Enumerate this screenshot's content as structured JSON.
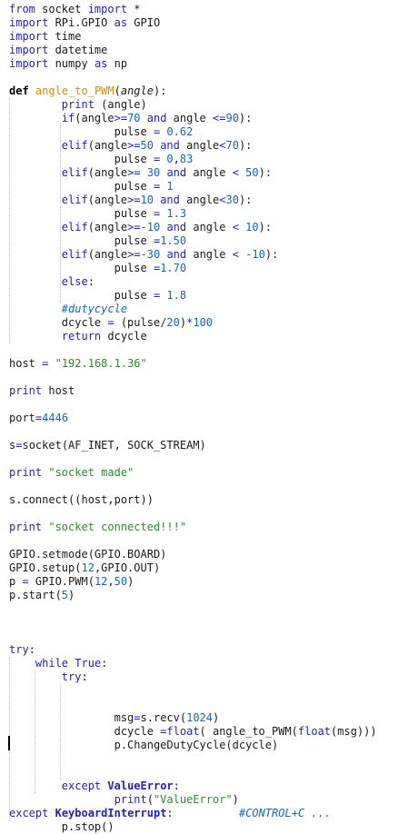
{
  "editor": {
    "language": "python",
    "lines": [
      [
        [
          "kw",
          "from"
        ],
        [
          "t",
          " socket "
        ],
        [
          "kw",
          "import"
        ],
        [
          "t",
          " *"
        ]
      ],
      [
        [
          "kw",
          "import"
        ],
        [
          "t",
          " RPi.GPIO "
        ],
        [
          "kw",
          "as"
        ],
        [
          "t",
          " GPIO"
        ]
      ],
      [
        [
          "kw",
          "import"
        ],
        [
          "t",
          " time"
        ]
      ],
      [
        [
          "kw",
          "import"
        ],
        [
          "t",
          " datetime"
        ]
      ],
      [
        [
          "kw",
          "import"
        ],
        [
          "t",
          " numpy "
        ],
        [
          "kw",
          "as"
        ],
        [
          "t",
          " np"
        ]
      ],
      [],
      [
        [
          "def",
          "def"
        ],
        [
          "t",
          " "
        ],
        [
          "fn",
          "angle_to_PWM"
        ],
        [
          "t",
          "("
        ],
        [
          "param",
          "angle"
        ],
        [
          "t",
          "):"
        ]
      ],
      [
        [
          "t",
          "        "
        ],
        [
          "kw",
          "print"
        ],
        [
          "t",
          " (angle)"
        ]
      ],
      [
        [
          "t",
          "        "
        ],
        [
          "kw",
          "if"
        ],
        [
          "t",
          "(angle"
        ],
        [
          "kw",
          ">="
        ],
        [
          "num",
          "70"
        ],
        [
          "t",
          " "
        ],
        [
          "kw",
          "and"
        ],
        [
          "t",
          " angle "
        ],
        [
          "kw",
          "<="
        ],
        [
          "num",
          "90"
        ],
        [
          "t",
          "):"
        ]
      ],
      [
        [
          "t",
          "                pulse "
        ],
        [
          "kw",
          "="
        ],
        [
          "t",
          " "
        ],
        [
          "num",
          "0.62"
        ]
      ],
      [
        [
          "t",
          "        "
        ],
        [
          "kw",
          "elif"
        ],
        [
          "t",
          "(angle"
        ],
        [
          "kw",
          ">="
        ],
        [
          "num",
          "50"
        ],
        [
          "t",
          " "
        ],
        [
          "kw",
          "and"
        ],
        [
          "t",
          " angle"
        ],
        [
          "kw",
          "<"
        ],
        [
          "num",
          "70"
        ],
        [
          "t",
          "):"
        ]
      ],
      [
        [
          "t",
          "                pulse "
        ],
        [
          "kw",
          "="
        ],
        [
          "t",
          " "
        ],
        [
          "num",
          "0"
        ],
        [
          "t",
          ","
        ],
        [
          "num",
          "83"
        ]
      ],
      [
        [
          "t",
          "        "
        ],
        [
          "kw",
          "elif"
        ],
        [
          "t",
          "(angle"
        ],
        [
          "kw",
          ">="
        ],
        [
          "t",
          " "
        ],
        [
          "num",
          "30"
        ],
        [
          "t",
          " "
        ],
        [
          "kw",
          "and"
        ],
        [
          "t",
          " angle "
        ],
        [
          "kw",
          "<"
        ],
        [
          "t",
          " "
        ],
        [
          "num",
          "50"
        ],
        [
          "t",
          "):"
        ]
      ],
      [
        [
          "t",
          "                pulse "
        ],
        [
          "kw",
          "="
        ],
        [
          "t",
          " "
        ],
        [
          "num",
          "1"
        ]
      ],
      [
        [
          "t",
          "        "
        ],
        [
          "kw",
          "elif"
        ],
        [
          "t",
          "(angle"
        ],
        [
          "kw",
          ">="
        ],
        [
          "num",
          "10"
        ],
        [
          "t",
          " "
        ],
        [
          "kw",
          "and"
        ],
        [
          "t",
          " angle"
        ],
        [
          "kw",
          "<"
        ],
        [
          "num",
          "30"
        ],
        [
          "t",
          "):"
        ]
      ],
      [
        [
          "t",
          "                pulse "
        ],
        [
          "kw",
          "="
        ],
        [
          "t",
          " "
        ],
        [
          "num",
          "1.3"
        ]
      ],
      [
        [
          "t",
          "        "
        ],
        [
          "kw",
          "elif"
        ],
        [
          "t",
          "(angle"
        ],
        [
          "kw",
          ">="
        ],
        [
          "num",
          "-10"
        ],
        [
          "t",
          " "
        ],
        [
          "kw",
          "and"
        ],
        [
          "t",
          " angle "
        ],
        [
          "kw",
          "<"
        ],
        [
          "t",
          " "
        ],
        [
          "num",
          "10"
        ],
        [
          "t",
          "):"
        ]
      ],
      [
        [
          "t",
          "                pulse "
        ],
        [
          "kw",
          "="
        ],
        [
          "num",
          "1.50"
        ]
      ],
      [
        [
          "t",
          "        "
        ],
        [
          "kw",
          "elif"
        ],
        [
          "t",
          "(angle"
        ],
        [
          "kw",
          ">="
        ],
        [
          "num",
          "-30"
        ],
        [
          "t",
          " "
        ],
        [
          "kw",
          "and"
        ],
        [
          "t",
          " angle "
        ],
        [
          "kw",
          "<"
        ],
        [
          "t",
          " "
        ],
        [
          "num",
          "-10"
        ],
        [
          "t",
          "):"
        ]
      ],
      [
        [
          "t",
          "                pulse "
        ],
        [
          "kw",
          "="
        ],
        [
          "num",
          "1.70"
        ]
      ],
      [
        [
          "t",
          "        "
        ],
        [
          "kw",
          "else"
        ],
        [
          "t",
          ":"
        ]
      ],
      [
        [
          "t",
          "                pulse "
        ],
        [
          "kw",
          "="
        ],
        [
          "t",
          " "
        ],
        [
          "num",
          "1.8"
        ]
      ],
      [
        [
          "t",
          "        "
        ],
        [
          "cmt",
          "#dutycycle"
        ]
      ],
      [
        [
          "t",
          "        dcycle "
        ],
        [
          "kw",
          "="
        ],
        [
          "t",
          " (pulse"
        ],
        [
          "kw",
          "/"
        ],
        [
          "num",
          "20"
        ],
        [
          "t",
          ")"
        ],
        [
          "kw",
          "*"
        ],
        [
          "num",
          "100"
        ]
      ],
      [
        [
          "t",
          "        "
        ],
        [
          "kw",
          "return"
        ],
        [
          "t",
          " dcycle"
        ]
      ],
      [],
      [
        [
          "t",
          "host "
        ],
        [
          "kw",
          "="
        ],
        [
          "t",
          " "
        ],
        [
          "str",
          "\"192.168.1.36\""
        ]
      ],
      [],
      [
        [
          "kw",
          "print"
        ],
        [
          "t",
          " host"
        ]
      ],
      [],
      [
        [
          "t",
          "port"
        ],
        [
          "kw",
          "="
        ],
        [
          "num",
          "4446"
        ]
      ],
      [],
      [
        [
          "t",
          "s"
        ],
        [
          "kw",
          "="
        ],
        [
          "t",
          "socket(AF_INET, SOCK_STREAM)"
        ]
      ],
      [],
      [
        [
          "kw",
          "print"
        ],
        [
          "t",
          " "
        ],
        [
          "str",
          "\"socket made\""
        ]
      ],
      [],
      [
        [
          "t",
          "s.connect((host,port))"
        ]
      ],
      [],
      [
        [
          "kw",
          "print"
        ],
        [
          "t",
          " "
        ],
        [
          "str",
          "\"socket connected!!!\""
        ]
      ],
      [],
      [
        [
          "t",
          "GPIO.setmode(GPIO.BOARD)"
        ]
      ],
      [
        [
          "t",
          "GPIO.setup("
        ],
        [
          "num",
          "12"
        ],
        [
          "t",
          ",GPIO.OUT)"
        ]
      ],
      [
        [
          "t",
          "p "
        ],
        [
          "kw",
          "="
        ],
        [
          "t",
          " GPIO.PWM("
        ],
        [
          "num",
          "12"
        ],
        [
          "t",
          ","
        ],
        [
          "num",
          "50"
        ],
        [
          "t",
          ")"
        ]
      ],
      [
        [
          "t",
          "p.start("
        ],
        [
          "num",
          "5"
        ],
        [
          "t",
          ")"
        ]
      ],
      [],
      [],
      [],
      [
        [
          "kw",
          "try"
        ],
        [
          "t",
          ":"
        ]
      ],
      [
        [
          "t",
          "    "
        ],
        [
          "kw",
          "while"
        ],
        [
          "t",
          " "
        ],
        [
          "kw",
          "True"
        ],
        [
          "t",
          ":"
        ]
      ],
      [
        [
          "t",
          "        "
        ],
        [
          "kw",
          "try"
        ],
        [
          "t",
          ":"
        ]
      ],
      [],
      [],
      [
        [
          "t",
          "                msg"
        ],
        [
          "kw",
          "="
        ],
        [
          "t",
          "s.recv("
        ],
        [
          "num",
          "1024"
        ],
        [
          "t",
          ")"
        ]
      ],
      [
        [
          "t",
          "                dcycle "
        ],
        [
          "kw",
          "="
        ],
        [
          "kw",
          "float"
        ],
        [
          "t",
          "( angle_to_PWM("
        ],
        [
          "kw",
          "float"
        ],
        [
          "t",
          "(msg)))"
        ]
      ],
      [
        [
          "t",
          "                p.ChangeDutyCycle(dcycle)"
        ]
      ],
      [],
      [],
      [
        [
          "t",
          "        "
        ],
        [
          "kw",
          "except"
        ],
        [
          "t",
          " "
        ],
        [
          "exc",
          "ValueError"
        ],
        [
          "t",
          ":"
        ]
      ],
      [
        [
          "t",
          "                "
        ],
        [
          "kw",
          "print"
        ],
        [
          "t",
          "("
        ],
        [
          "str",
          "\"ValueError\""
        ],
        [
          "t",
          ")"
        ]
      ],
      [
        [
          "kw",
          "except"
        ],
        [
          "t",
          " "
        ],
        [
          "exc",
          "KeyboardInterrupt"
        ],
        [
          "t",
          ":          "
        ],
        [
          "cmt",
          "#CONTROL+C ..."
        ]
      ],
      [
        [
          "t",
          "        p.stop()"
        ]
      ]
    ]
  }
}
